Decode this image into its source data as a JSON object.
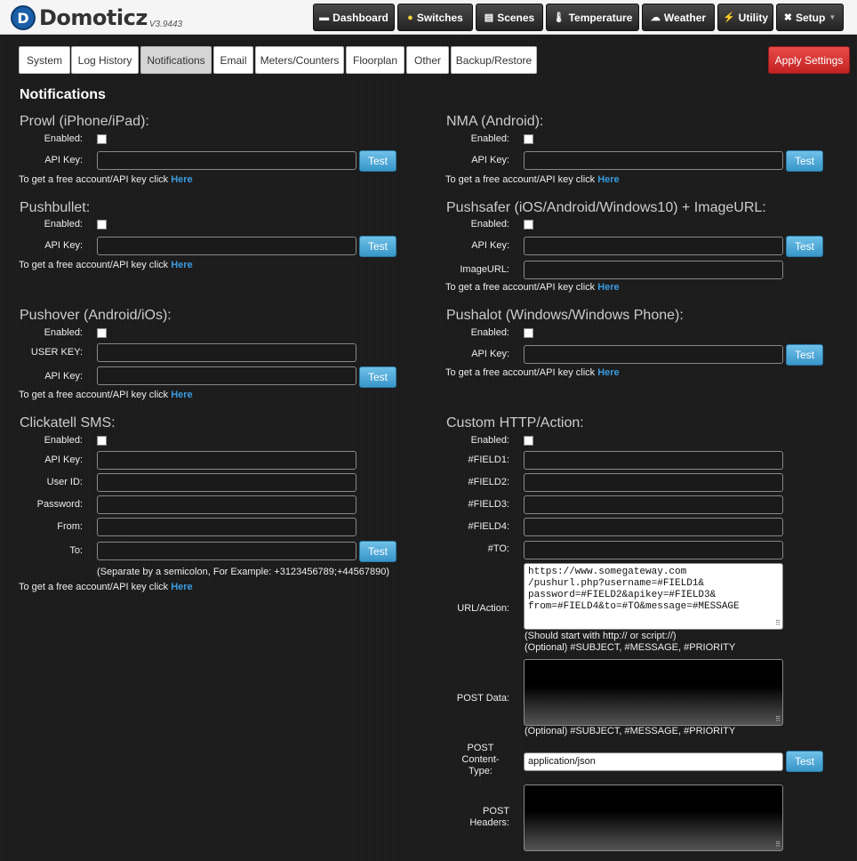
{
  "app": {
    "logo_letter": "D",
    "name": "Domoticz",
    "version": "V3.9443"
  },
  "nav": {
    "dashboard": "Dashboard",
    "switches": "Switches",
    "scenes": "Scenes",
    "temperature": "Temperature",
    "weather": "Weather",
    "utility": "Utility",
    "setup": "Setup"
  },
  "tabs": [
    "System",
    "Log History",
    "Notifications",
    "Email",
    "Meters/Counters",
    "Floorplan",
    "Other",
    "Backup/Restore"
  ],
  "apply_label": "Apply Settings",
  "page_title": "Notifications",
  "common": {
    "test": "Test",
    "free_text": "To get a free account/API key click",
    "here": "Here",
    "enabled": "Enabled:",
    "api_key": "API Key:"
  },
  "prowl": {
    "title": "Prowl (iPhone/iPad):"
  },
  "nma": {
    "title": "NMA (Android):"
  },
  "pushbullet": {
    "title": "Pushbullet:"
  },
  "pushsafer": {
    "title": "Pushsafer (iOS/Android/Windows10) + ImageURL:",
    "image_url_label": "ImageURL:"
  },
  "pushover": {
    "title": "Pushover (Android/iOs):",
    "user_key_label": "USER KEY:"
  },
  "pushalot": {
    "title": "Pushalot (Windows/Windows Phone):"
  },
  "clickatell": {
    "title": "Clickatell SMS:",
    "api_key_label": "API Key:",
    "user_id_label": "User ID:",
    "password_label": "Password:",
    "from_label": "From:",
    "to_label": "To:",
    "to_hint": "(Separate by a semicolon, For Example: +3123456789;+44567890)"
  },
  "custom_http": {
    "title": "Custom HTTP/Action:",
    "field1_label": "#FIELD1:",
    "field2_label": "#FIELD2:",
    "field3_label": "#FIELD3:",
    "field4_label": "#FIELD4:",
    "to_label": "#TO:",
    "url_label": "URL/Action:",
    "url_value": "https://www.somegateway.com\n/pushurl.php?username=#FIELD1&\npassword=#FIELD2&apikey=#FIELD3&\nfrom=#FIELD4&to=#TO&message=#MESSAGE",
    "url_hint1": "(Should start with http:// or script://)",
    "url_hint2": "(Optional) #SUBJECT, #MESSAGE, #PRIORITY",
    "post_data_label": "POST Data:",
    "post_hint": "(Optional) #SUBJECT, #MESSAGE, #PRIORITY",
    "content_type_label_1": "POST",
    "content_type_label_2": "Content-",
    "content_type_label_3": "Type:",
    "content_type_value": "application/json",
    "headers_label_1": "POST",
    "headers_label_2": "Headers:"
  }
}
